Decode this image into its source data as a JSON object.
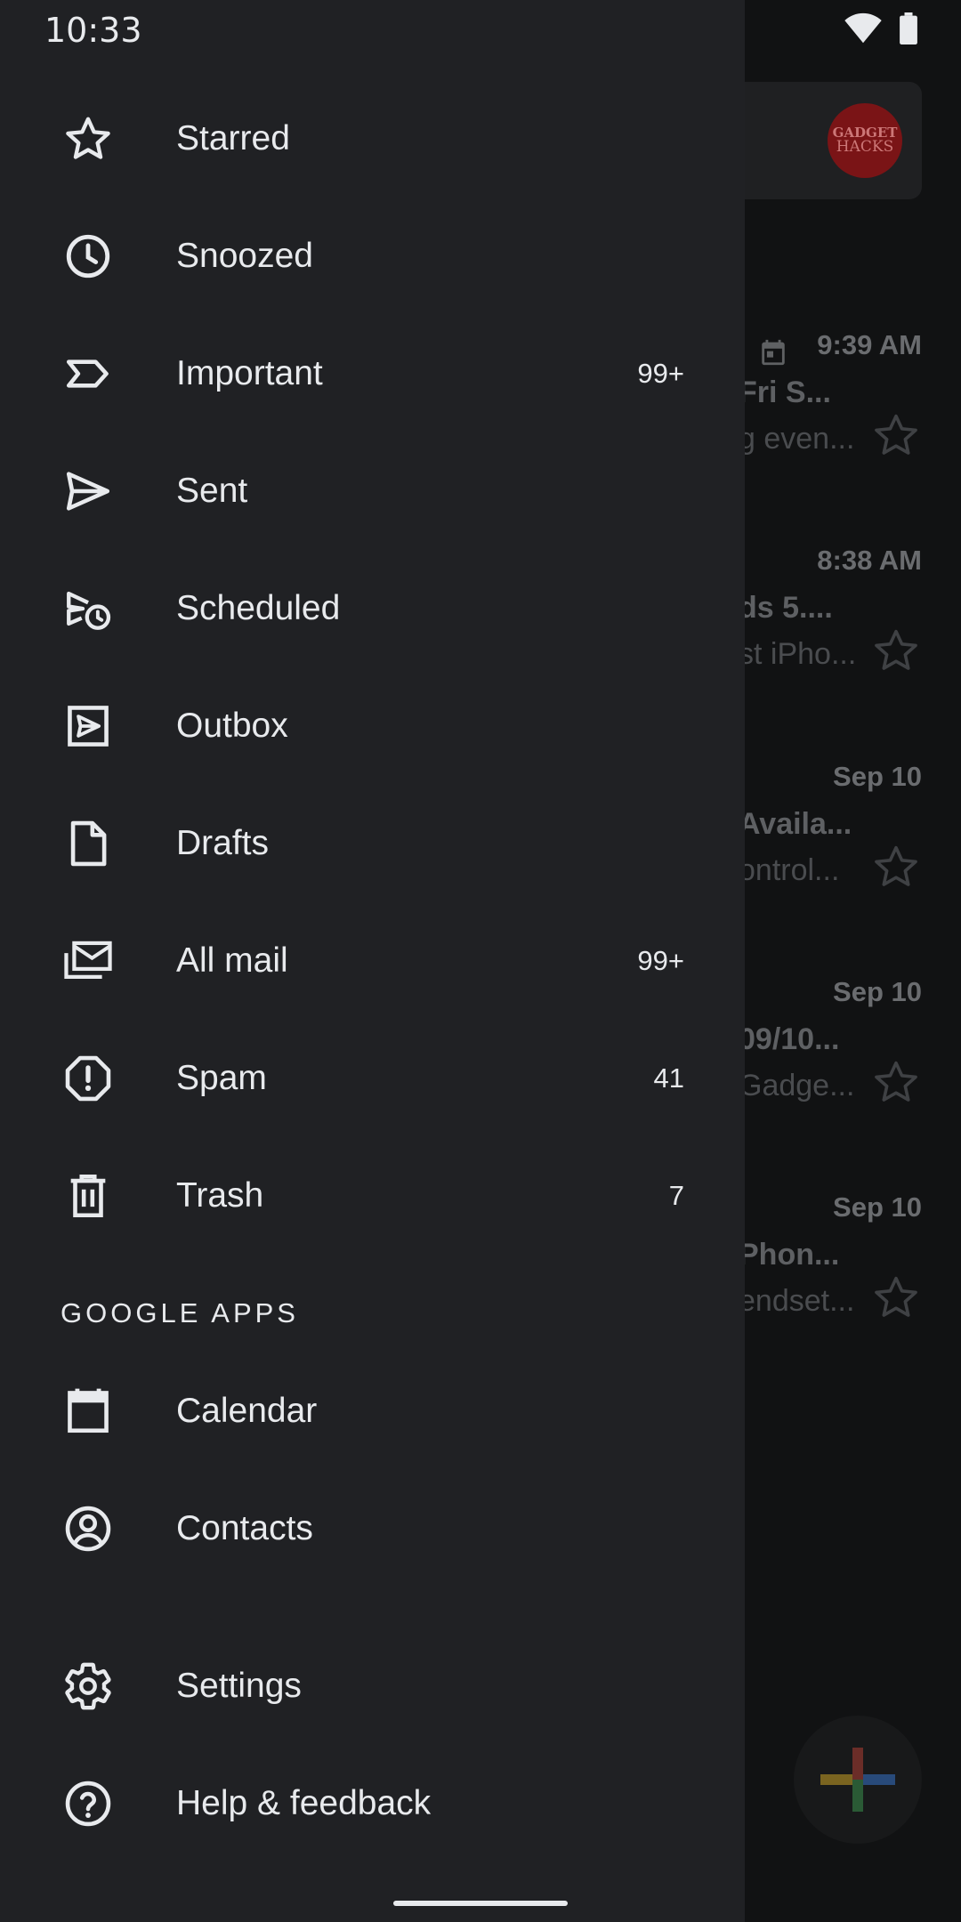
{
  "status_bar": {
    "time": "10:33"
  },
  "background": {
    "avatar": {
      "line1": "GADGET",
      "line2": "HACKS"
    },
    "mails": [
      {
        "time": "9:39 AM",
        "subject": "Fri S...",
        "preview": "g even..."
      },
      {
        "time": "8:38 AM",
        "subject": "ds 5....",
        "preview": "st iPho..."
      },
      {
        "time": "Sep 10",
        "subject": "Availa...",
        "preview": "ontrol..."
      },
      {
        "time": "Sep 10",
        "subject": "09/10...",
        "preview": "Gadge..."
      },
      {
        "time": "Sep 10",
        "subject": "Phon...",
        "preview": "endset..."
      }
    ]
  },
  "drawer": {
    "items": [
      {
        "label": "Starred",
        "count": "",
        "icon": "star-icon"
      },
      {
        "label": "Snoozed",
        "count": "",
        "icon": "clock-icon"
      },
      {
        "label": "Important",
        "count": "99+",
        "icon": "important-label-icon"
      },
      {
        "label": "Sent",
        "count": "",
        "icon": "send-icon"
      },
      {
        "label": "Scheduled",
        "count": "",
        "icon": "scheduled-send-icon"
      },
      {
        "label": "Outbox",
        "count": "",
        "icon": "outbox-icon"
      },
      {
        "label": "Drafts",
        "count": "",
        "icon": "draft-icon"
      },
      {
        "label": "All mail",
        "count": "99+",
        "icon": "all-mail-icon"
      },
      {
        "label": "Spam",
        "count": "41",
        "icon": "spam-icon"
      },
      {
        "label": "Trash",
        "count": "7",
        "icon": "trash-icon"
      }
    ],
    "google_apps_header": "GOOGLE APPS",
    "apps": [
      {
        "label": "Calendar",
        "icon": "calendar-icon"
      },
      {
        "label": "Contacts",
        "icon": "contacts-icon"
      }
    ],
    "footer": [
      {
        "label": "Settings",
        "icon": "gear-icon"
      },
      {
        "label": "Help & feedback",
        "icon": "help-icon"
      }
    ]
  },
  "colors": {
    "drawer_bg": "#202124",
    "text": "#e8eaed",
    "scrim_bg": "#111213",
    "fab_red": "#ea4335",
    "fab_blue": "#4285f4",
    "fab_green": "#34a853",
    "fab_yellow": "#fbbc04"
  }
}
